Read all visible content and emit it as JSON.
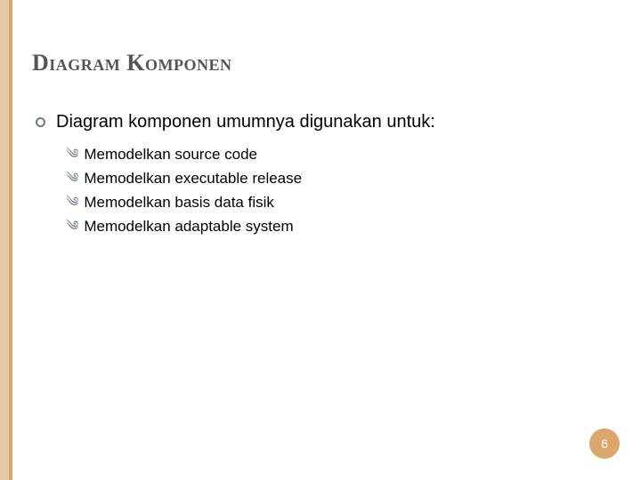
{
  "title": "Diagram Komponen",
  "main_bullet": "Diagram komponen umumnya digunakan untuk:",
  "sub_items": [
    "Memodelkan source code",
    "Memodelkan executable release",
    "Memodelkan basis data fisik",
    "Memodelkan adaptable system"
  ],
  "page_number": "6"
}
